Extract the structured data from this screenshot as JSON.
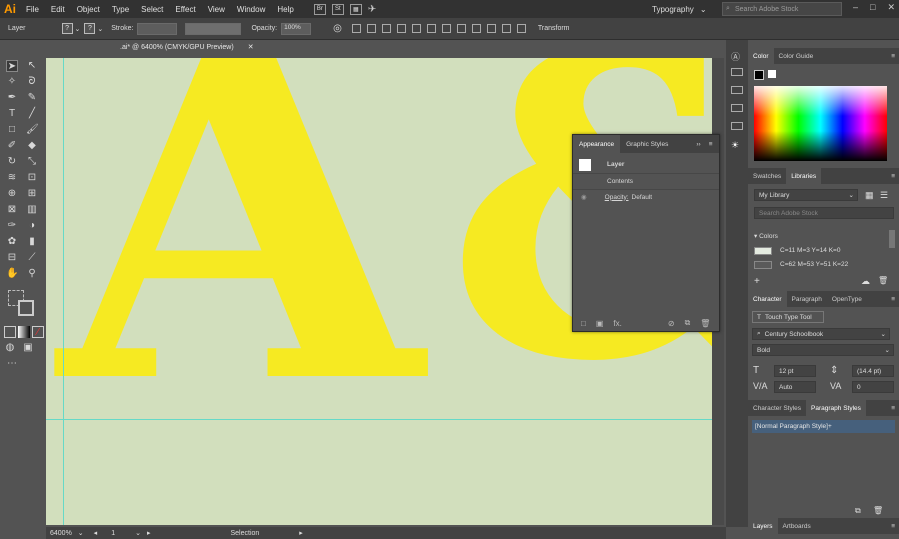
{
  "app_logo": "Ai",
  "menu": [
    "File",
    "Edit",
    "Object",
    "Type",
    "Select",
    "Effect",
    "View",
    "Window",
    "Help"
  ],
  "menu_icons": [
    "Br",
    "St"
  ],
  "workspace": "Typography",
  "search_placeholder": "Search Adobe Stock",
  "control_bar": {
    "selection_label": "Layer",
    "stroke_label": "Stroke:",
    "opacity_label": "Opacity:",
    "opacity_value": "100%",
    "transform_label": "Transform"
  },
  "document_tab": ".ai* @ 6400% (CMYK/GPU Preview)",
  "canvas": {
    "glyph_a": "A",
    "glyph_amp": "&",
    "background": "#d2dfbd",
    "glyph_color": "#f6ea22"
  },
  "status": {
    "zoom": "6400%",
    "artboard": "1",
    "tool": "Selection"
  },
  "appearance_panel": {
    "tabs": [
      "Appearance",
      "Graphic Styles"
    ],
    "rows": [
      "Layer",
      "Contents",
      "Opacity:",
      "Default"
    ],
    "footer_fx": "fx."
  },
  "color_panel": {
    "tabs": [
      "Color",
      "Color Guide"
    ]
  },
  "libraries_panel": {
    "tabs": [
      "Swatches",
      "Libraries"
    ],
    "library": "My Library",
    "search_placeholder": "Search Adobe Stock",
    "colors_heading": "Colors",
    "swatches": [
      {
        "label": "C=11 M=3 Y=14 K=0",
        "color": "#e4ebe0"
      },
      {
        "label": "C=62 M=53 Y=51 K=22",
        "color": "#5a5a5a"
      }
    ]
  },
  "character_panel": {
    "tabs": [
      "Character",
      "Paragraph",
      "OpenType"
    ],
    "touch_type": "Touch Type Tool",
    "font_family": "Century Schoolbook",
    "font_style": "Bold",
    "size": "12 pt",
    "leading": "(14.4 pt)",
    "kerning": "Auto",
    "tracking": "0"
  },
  "styles_panel": {
    "tabs": [
      "Character Styles",
      "Paragraph Styles"
    ],
    "selected_style": "[Normal Paragraph Style]+"
  },
  "bottom_panel": {
    "tabs": [
      "Layers",
      "Artboards"
    ]
  }
}
